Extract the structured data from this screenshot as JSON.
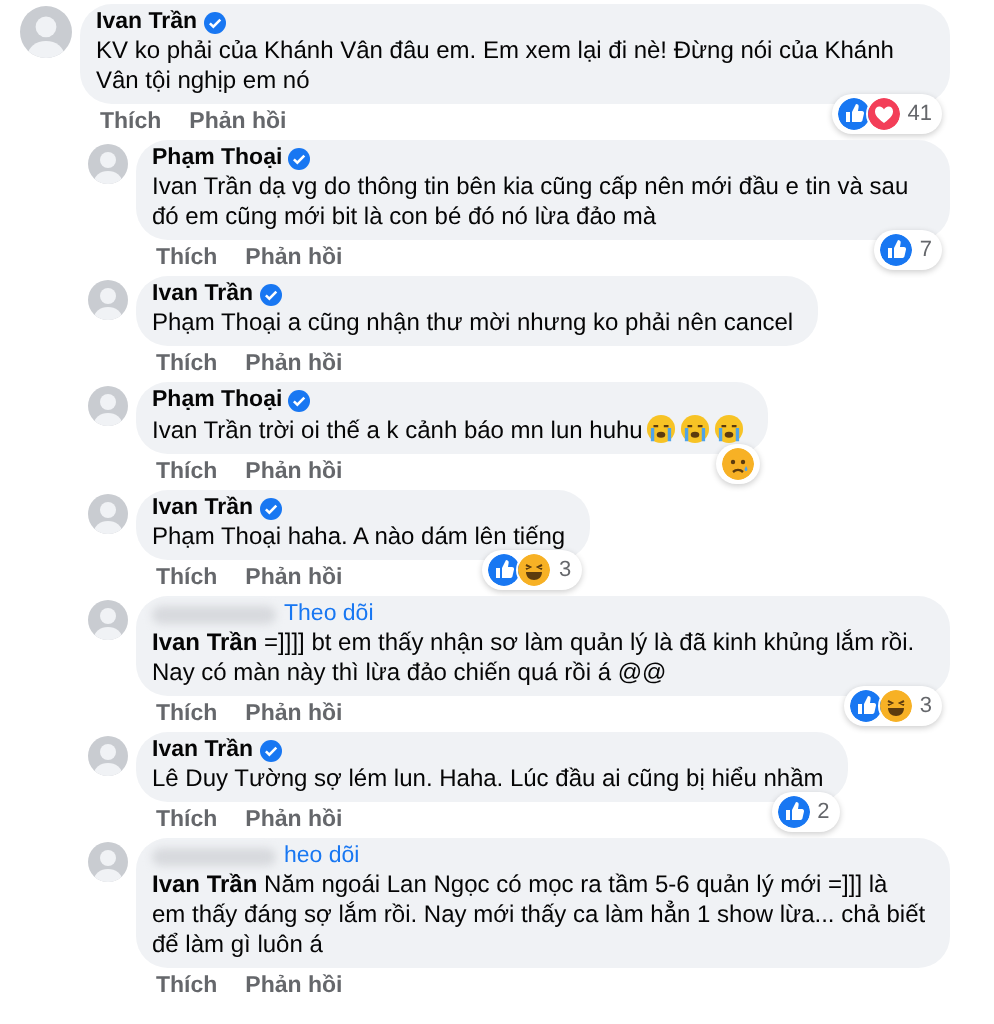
{
  "comments": [
    {
      "kind": "top",
      "author": "Ivan Trần",
      "verified": true,
      "text": "KV ko phải của Khánh Vân đâu em. Em xem lại đi nè! Đừng nói của Khánh Vân tội nghịp em nó",
      "reactions": [
        {
          "kind": "like"
        },
        {
          "kind": "love"
        }
      ],
      "reaction_count": "41",
      "actions": [
        "Thích",
        "Phản hồi"
      ]
    },
    {
      "kind": "reply",
      "author": "Phạm Thoại",
      "verified": true,
      "text": "Ivan Trần dạ vg do thông tin bên kia cũng cấp nên mới đầu e tin và sau đó em cũng mới bit là con bé đó nó lừa đảo mà",
      "reactions": [
        {
          "kind": "like"
        }
      ],
      "reaction_count": "7",
      "actions": [
        "Thích",
        "Phản hồi"
      ]
    },
    {
      "kind": "reply",
      "author": "Ivan Trần",
      "verified": true,
      "text": "Phạm Thoại a cũng nhận thư mời nhưng ko phải nên cancel",
      "actions": [
        "Thích",
        "Phản hồi"
      ]
    },
    {
      "kind": "reply",
      "author": "Phạm Thoại",
      "verified": true,
      "text": "Ivan Trần trời oi thế a k cảnh báo mn lun huhu",
      "emoji": [
        {
          "kind": "crying"
        },
        {
          "kind": "crying"
        },
        {
          "kind": "crying"
        }
      ],
      "reactions": [
        {
          "kind": "sad"
        }
      ],
      "actions": [
        "Thích",
        "Phản hồi"
      ]
    },
    {
      "kind": "reply",
      "author": "Ivan Trần",
      "verified": true,
      "text": "Phạm Thoại haha. A nào dám lên tiếng",
      "reactions": [
        {
          "kind": "like"
        },
        {
          "kind": "haha"
        }
      ],
      "reaction_count": "3",
      "actions": [
        "Thích",
        "Phản hồi"
      ]
    },
    {
      "kind": "reply",
      "name_blurred": true,
      "follow": "Theo dõi",
      "text": "**Ivan Trần** =]]]] bt em thấy nhận sơ làm quản lý là đã kinh khủng lắm rồi. Nay có màn này thì lừa đảo chiến quá rồi á @@",
      "reactions": [
        {
          "kind": "like"
        },
        {
          "kind": "haha"
        }
      ],
      "reaction_count": "3",
      "actions": [
        "Thích",
        "Phản hồi"
      ]
    },
    {
      "kind": "reply",
      "author": "Ivan Trần",
      "verified": true,
      "text": "Lê Duy Tường sợ lém lun. Haha. Lúc đầu ai cũng bị hiểu nhầm",
      "reactions": [
        {
          "kind": "like"
        }
      ],
      "reaction_count": "2",
      "actions": [
        "Thích",
        "Phản hồi"
      ]
    },
    {
      "kind": "reply",
      "name_blurred": true,
      "follow": "heo dõi",
      "text": "**Ivan Trần** Năm ngoái Lan Ngọc có mọc ra tầm 5-6 quản lý mới =]]] là em thấy đáng sợ lắm rồi. Nay mới thấy ca làm hẳn 1 show lừa... chả biết để làm gì luôn á",
      "actions": [
        "Thích",
        "Phản hồi"
      ]
    }
  ]
}
